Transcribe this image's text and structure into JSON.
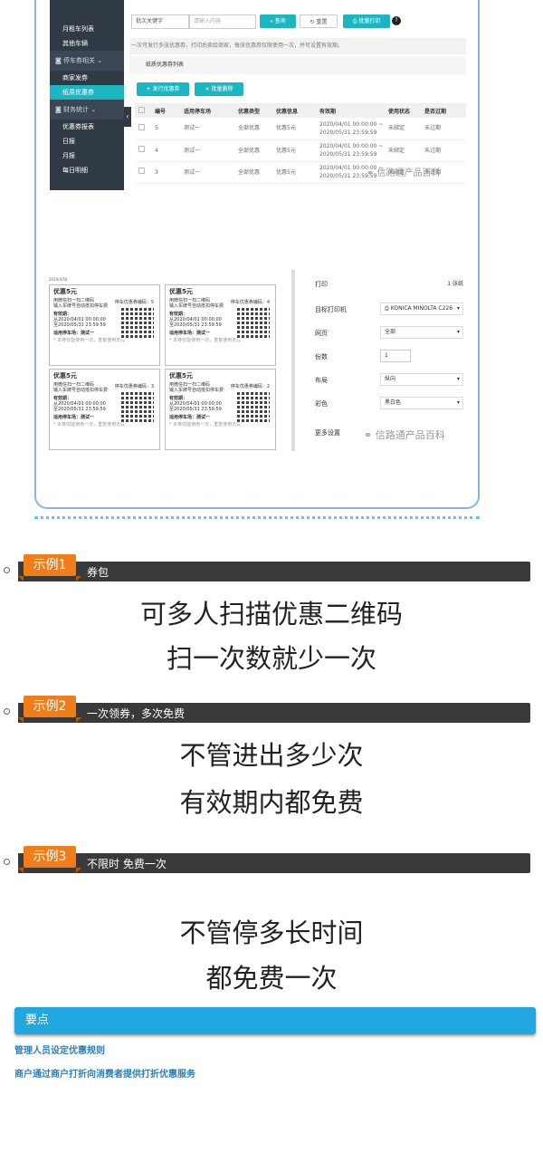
{
  "sidebar": {
    "items": [
      "月租车列表",
      "其他车辆"
    ],
    "group1": "停车券相关",
    "items2": [
      "商家发券",
      "纸质优惠券"
    ],
    "group2": "财务统计",
    "items3": [
      "优惠券报表",
      "日报",
      "月报",
      "每日明细"
    ]
  },
  "toolbar": {
    "keyword_label": "批次关键字",
    "keyword_placeholder": "请输入内容",
    "query": "查询",
    "reset": "重置",
    "batch_print": "批量打印",
    "help": "?"
  },
  "notice": "一次可发行多张优惠券，打印后卖给商家，每张优惠券仅限使用一次，并可设置有效期。",
  "list_title": "纸质优惠券列表",
  "actions": {
    "issue": "+ 发行优惠券",
    "delete": "× 批量删除"
  },
  "table": {
    "headers": [
      "",
      "编号",
      "适用停车场",
      "优惠类型",
      "优惠信息",
      "有效期",
      "使用状态",
      "是否过期"
    ],
    "rows": [
      [
        "",
        "5",
        "测试一",
        "全部优惠",
        "优惠5元",
        "2020/04/01 00:00:00 ~ 2020/05/31 23:59:59",
        "未绑定",
        "未过期"
      ],
      [
        "",
        "4",
        "测试一",
        "全部优惠",
        "优惠5元",
        "2020/04/01 00:00:00 ~ 2020/05/31 23:59:59",
        "未绑定",
        "未过期"
      ],
      [
        "",
        "3",
        "测试一",
        "全部优惠",
        "优惠5元",
        "2020/04/01 00:00:00 ~ 2020/05/31 23:59:59",
        "未绑定",
        "未过期"
      ]
    ]
  },
  "watermark": "信路通产品百科",
  "preview": {
    "date": "2020/4/28",
    "coupons": [
      {
        "title": "优惠5元",
        "no": "停车优惠券编码：5"
      },
      {
        "title": "优惠5元",
        "no": "停车优惠券编码：4"
      },
      {
        "title": "优惠5元",
        "no": "停车优惠券编码：3"
      },
      {
        "title": "优惠5元",
        "no": "停车优惠券编码：2"
      }
    ],
    "line1": "用微信扫一扫二维码",
    "line2": "输入车牌号自动抵扣停车费",
    "valid": "有效期：",
    "from": "从2020/04/01 00:00:00",
    "to": "至2020/05/31 23:59:59",
    "park": "适用停车场：测试一",
    "note": "* 本券仅能使用一次，重复使用无效"
  },
  "print": {
    "title": "打印",
    "sheets": "1 张纸",
    "printer_label": "目标打印机",
    "printer": "KONICA MINOLTA C226",
    "pages_label": "网页",
    "pages": "全部",
    "copies_label": "份数",
    "copies": "1",
    "layout_label": "布局",
    "layout": "纵向",
    "color_label": "彩色",
    "color": "黑白色",
    "more": "更多设置"
  },
  "examples": [
    {
      "tag": "示例1",
      "sub": "券包",
      "lines": [
        "可多人扫描优惠二维码",
        "扫一次数就少一次"
      ]
    },
    {
      "tag": "示例2",
      "sub": "一次领券，多次免费",
      "lines": [
        "不管进出多少次",
        "有效期内都免费"
      ]
    },
    {
      "tag": "示例3",
      "sub": "不限时 免费一次",
      "lines": [
        "不管停多长时间",
        "都免费一次"
      ]
    }
  ],
  "keypoints": {
    "title": "要点",
    "items": [
      "管理人员设定优惠规则",
      "商户通过商户打折向消费者提供打折优惠服务"
    ]
  }
}
